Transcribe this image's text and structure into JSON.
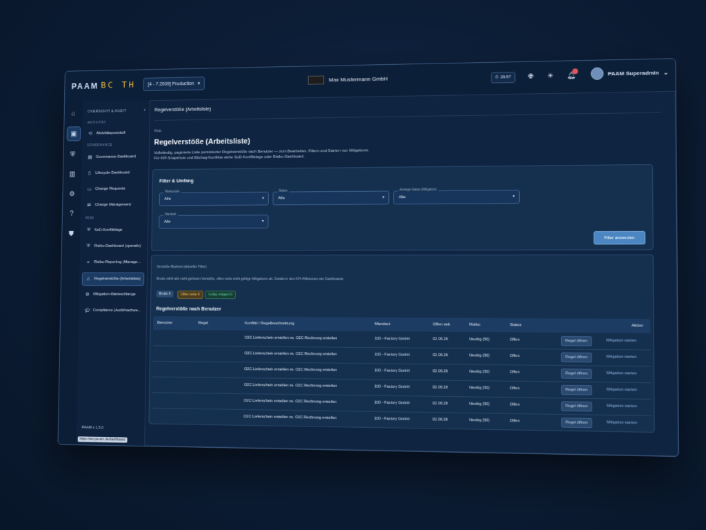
{
  "app": {
    "logo_text": "PAAM",
    "brand_text": "BC TH",
    "environment_select": "[4 - 7.2009] Production",
    "company": "Max Mustermann GmbH",
    "company_logo_text": "",
    "clock": "29:57",
    "user": "PAAM Superadmin"
  },
  "icons": {
    "rail": [
      "home-icon",
      "monitor-icon",
      "shield-icon",
      "building-icon",
      "cog-icon",
      "help-icon",
      "shield-badge-icon"
    ],
    "top": [
      "timer-icon",
      "globe-icon",
      "sun-icon",
      "bell-icon",
      "chevron-down-icon"
    ]
  },
  "nav": {
    "header": "OVERSIGHT & AUDIT",
    "sections": {
      "activity": "AKTIVITÄT",
      "governance": "GOVERNANCE",
      "risk": "RISK"
    },
    "items": [
      {
        "label": "Aktivitätsprotokoll",
        "icon": "history-icon"
      },
      {
        "label": "Governance-Dashboard",
        "icon": "dashboard-icon"
      },
      {
        "label": "Lifecycle-Dashboard",
        "icon": "file-icon"
      },
      {
        "label": "Change Requests",
        "icon": "clipboard-icon"
      },
      {
        "label": "Change Management",
        "icon": "swap-icon"
      },
      {
        "label": "SoD-Konfliktlage",
        "icon": "shield-icon"
      },
      {
        "label": "Risiko-Dashboard (operativ)",
        "icon": "shield-icon"
      },
      {
        "label": "Risiko-Reporting (Manage...",
        "icon": "list-icon"
      },
      {
        "label": "Regelverstöße (Arbeitsliste)",
        "icon": "warning-icon",
        "active": true
      },
      {
        "label": "Mitigation-Warteschlange",
        "icon": "gear-icon"
      },
      {
        "label": "Compliance (Audit/nachwe...",
        "icon": "graduation-icon"
      }
    ],
    "version": "PAAM v 1.5.0",
    "status_url": "https://am.pa-am.de/dashboard"
  },
  "page": {
    "top_title": "Regelverstöße (Arbeitsliste)",
    "breadcrumb": "Risk",
    "title": "Regelverstöße (Arbeitsliste)",
    "subtitle": "Vollständig, paginierte Liste persistierter Regelverstöße nach Benutzer — zum Bearbeiten, Filtern und Starten von Mitigations. Für KPI-Snapshots und Bitchag-Konflikte siehe SoD-Konfliktlage oder Risiko-Dashboard."
  },
  "filters": {
    "title": "Filter & Umfang",
    "fields": [
      {
        "label": "Risikostufe",
        "value": "Alle"
      },
      {
        "label": "Status",
        "value": "Alle"
      },
      {
        "label": "Anzeige-Status (Mitigation)",
        "value": "Alle"
      },
      {
        "label": "Mandant",
        "value": "Alle"
      }
    ],
    "apply_label": "Filter anwenden"
  },
  "buckets": {
    "title": "Verstöße-Buckets (aktueller Filter)",
    "note": "Brutto zählt alle nicht gelösten Verstöße, offen netto zieht gültige Mitigations ab. Details in den KPI-Hilfetexten der Dashboards.",
    "chips": {
      "brutto": "Brutto 6",
      "offen_netto": "Offen netto 6",
      "gueltig": "Gültig mitigiert 0"
    }
  },
  "table": {
    "title": "Regelverstöße nach Benutzer",
    "columns": [
      "Benutzer",
      "Regel",
      "Konflikt / Regelbeschreibung",
      "Mandant",
      "Offen seit",
      "Risiko",
      "Status",
      "Aktion"
    ],
    "rows": [
      {
        "user": "",
        "rule": "",
        "conflict": "O2C Lieferschein erstellen vs. O2C Rechnung erstellen",
        "mandant": "100 - Factory GmbH",
        "since": "02.06.26",
        "risk": "Niedrig (50)",
        "status": "Offen"
      },
      {
        "user": "",
        "rule": "",
        "conflict": "O2C Lieferschein erstellen vs. O2C Rechnung erstellen",
        "mandant": "100 - Factory GmbH",
        "since": "02.06.26",
        "risk": "Niedrig (50)",
        "status": "Offen"
      },
      {
        "user": "",
        "rule": "",
        "conflict": "O2C Lieferschein erstellen vs. O2C Rechnung erstellen",
        "mandant": "100 - Factory GmbH",
        "since": "02.06.26",
        "risk": "Niedrig (50)",
        "status": "Offen"
      },
      {
        "user": "",
        "rule": "",
        "conflict": "O2C Lieferschein erstellen vs. O2C Rechnung erstellen",
        "mandant": "100 - Factory GmbH",
        "since": "02.06.26",
        "risk": "Niedrig (50)",
        "status": "Offen"
      },
      {
        "user": "",
        "rule": "",
        "conflict": "O2C Lieferschein erstellen vs. O2C Rechnung erstellen",
        "mandant": "100 - Factory GmbH",
        "since": "02.06.26",
        "risk": "Niedrig (50)",
        "status": "Offen"
      },
      {
        "user": "",
        "rule": "",
        "conflict": "O2C Lieferschein erstellen vs. O2C Rechnung erstellen",
        "mandant": "100 - Factory GmbH",
        "since": "02.06.26",
        "risk": "Niedrig (50)",
        "status": "Offen"
      }
    ],
    "open_rule_label": "Regel öffnen",
    "start_mitigation_label": "Mitigation starten"
  },
  "colors": {
    "background": "#0c1d36",
    "accent": "#4b86c2",
    "brand": "#e2b23c",
    "warning_chip": "#f0c36a",
    "success_chip": "#5fd1a0"
  }
}
